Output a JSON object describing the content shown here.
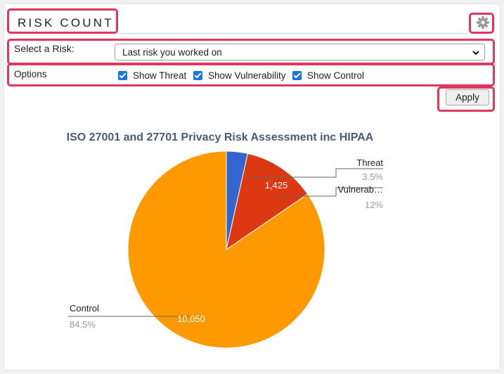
{
  "header": {
    "title": "RISK COUNT",
    "settings_icon": "gear-icon"
  },
  "select_risk": {
    "label": "Select a Risk:",
    "value": "Last risk you worked on"
  },
  "options": {
    "label": "Options",
    "items": [
      {
        "label": "Show Threat",
        "checked": true
      },
      {
        "label": "Show Vulnerability",
        "checked": true
      },
      {
        "label": "Show Control",
        "checked": true
      }
    ]
  },
  "apply_label": "Apply",
  "colors": {
    "highlight": "#e0375c",
    "threat": "#3366cc",
    "vulnerability": "#dc3912",
    "control": "#ff9900"
  },
  "chart_data": {
    "type": "pie",
    "title": "ISO 27001 and 27701 Privacy Risk Assessment inc HIPAA",
    "slices": [
      {
        "name": "Threat",
        "label": "Threat",
        "value": 415,
        "percent_label": "3.5%",
        "value_label": "",
        "color": "#3366cc"
      },
      {
        "name": "Vulnerability",
        "label": "Vulnerab…",
        "value": 1425,
        "percent_label": "12%",
        "value_label": "1,425",
        "color": "#dc3912"
      },
      {
        "name": "Control",
        "label": "Control",
        "value": 10050,
        "percent_label": "84.5%",
        "value_label": "10,050",
        "color": "#ff9900"
      }
    ]
  }
}
